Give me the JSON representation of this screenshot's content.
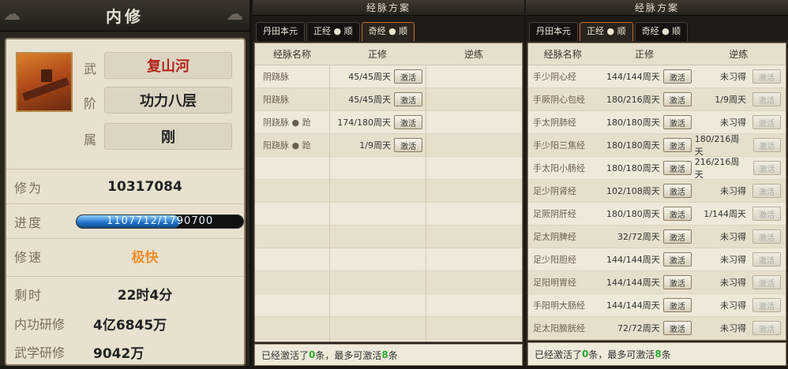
{
  "left": {
    "title": "内修",
    "name_label": "武",
    "name": "复山河",
    "rank_label": "阶",
    "rank": "功力八层",
    "attr_label": "属",
    "attr": "刚",
    "cultivation_label": "修为",
    "cultivation": "10317084",
    "progress_label": "进度",
    "progress_text": "1107712/1790700",
    "progress_fraction": 0.6186,
    "speed_label": "修速",
    "speed": "极快",
    "remaining_label": "剩时",
    "remaining": "22时4分",
    "inner_label": "内功研修",
    "inner": "4亿6845万",
    "martial_label": "武学研修",
    "martial": "9042万"
  },
  "mid": {
    "title": "经脉方案",
    "tabs": [
      "丹田本元",
      "正经 ● 顺",
      "奇经 ● 顺"
    ],
    "active_tab": 2,
    "headers": [
      "经脉名称",
      "正修",
      "逆练"
    ],
    "rows": [
      {
        "name": "阴跷脉",
        "zx": "45/45周天",
        "btn": "激活"
      },
      {
        "name": "阳跷脉",
        "zx": "45/45周天",
        "btn": "激活"
      },
      {
        "name": "阴跷脉 ● 跄",
        "zx": "174/180周天",
        "btn": "激活"
      },
      {
        "name": "阳跷脉 ● 跄",
        "zx": "1/9周天",
        "btn": "激活"
      }
    ],
    "empty_rows": 9,
    "footer_prefix": "已经激活了",
    "footer_count": "0",
    "footer_mid": "条，最多可激活",
    "footer_max": "8",
    "footer_suffix": "条"
  },
  "right": {
    "title": "经脉方案",
    "tabs": [
      "丹田本元",
      "正经 ● 顺",
      "奇经 ● 顺"
    ],
    "active_tab": 1,
    "headers": [
      "经脉名称",
      "正修",
      "逆练"
    ],
    "rows": [
      {
        "name": "手少阴心经",
        "zx": "144/144周天",
        "btn": "激活",
        "nl": "未习得"
      },
      {
        "name": "手厥阴心包经",
        "zx": "180/216周天",
        "btn": "激活",
        "nl": "1/9周天"
      },
      {
        "name": "手太阴肺经",
        "zx": "180/180周天",
        "btn": "激活",
        "nl": "未习得"
      },
      {
        "name": "手少阳三焦经",
        "zx": "180/180周天",
        "btn": "激活",
        "nl": "180/216周天"
      },
      {
        "name": "手太阳小肠经",
        "zx": "180/180周天",
        "btn": "激活",
        "nl": "216/216周天"
      },
      {
        "name": "足少阴肾经",
        "zx": "102/108周天",
        "btn": "激活",
        "nl": "未习得"
      },
      {
        "name": "足厥阴肝经",
        "zx": "180/180周天",
        "btn": "激活",
        "nl": "1/144周天"
      },
      {
        "name": "足太阴脾经",
        "zx": "32/72周天",
        "btn": "激活",
        "nl": "未习得"
      },
      {
        "name": "足少阳胆经",
        "zx": "144/144周天",
        "btn": "激活",
        "nl": "未习得"
      },
      {
        "name": "足阳明胃经",
        "zx": "144/144周天",
        "btn": "激活",
        "nl": "未习得"
      },
      {
        "name": "手阳明大肠经",
        "zx": "144/144周天",
        "btn": "激活",
        "nl": "未习得"
      },
      {
        "name": "足太阳膀胱经",
        "zx": "72/72周天",
        "btn": "激活",
        "nl": "未习得"
      }
    ],
    "footer_prefix": "已经激活了",
    "footer_count": "0",
    "footer_mid": "条，最多可激活",
    "footer_max": "8",
    "footer_suffix": "条"
  },
  "colors": {
    "name": "#b3261e",
    "speed": "#f0902a",
    "footer_count": "#2aa830"
  }
}
